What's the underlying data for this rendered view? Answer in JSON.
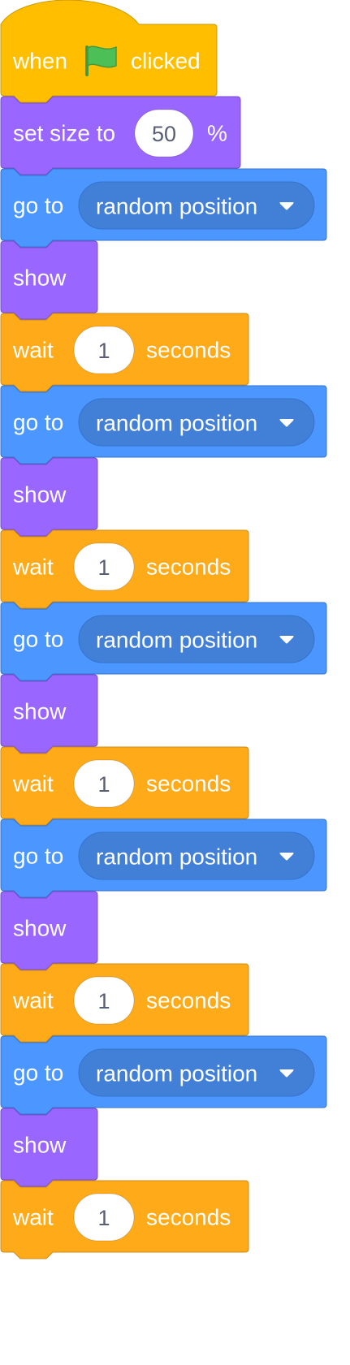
{
  "script": {
    "hat": {
      "when_label": "when",
      "flag_icon": "green-flag-icon",
      "clicked_label": "clicked"
    },
    "set_size": {
      "label": "set size to",
      "value": "50",
      "unit_label": "%"
    },
    "blocks": [
      {
        "type": "goto",
        "label": "go to",
        "menu_value": "random position"
      },
      {
        "type": "show",
        "label": "show"
      },
      {
        "type": "wait",
        "label": "wait",
        "value": "1",
        "unit_label": "seconds"
      },
      {
        "type": "goto",
        "label": "go to",
        "menu_value": "random position"
      },
      {
        "type": "show",
        "label": "show"
      },
      {
        "type": "wait",
        "label": "wait",
        "value": "1",
        "unit_label": "seconds"
      },
      {
        "type": "goto",
        "label": "go to",
        "menu_value": "random position"
      },
      {
        "type": "show",
        "label": "show"
      },
      {
        "type": "wait",
        "label": "wait",
        "value": "1",
        "unit_label": "seconds"
      },
      {
        "type": "goto",
        "label": "go to",
        "menu_value": "random position"
      },
      {
        "type": "show",
        "label": "show"
      },
      {
        "type": "wait",
        "label": "wait",
        "value": "1",
        "unit_label": "seconds"
      },
      {
        "type": "goto",
        "label": "go to",
        "menu_value": "random position"
      },
      {
        "type": "show",
        "label": "show"
      },
      {
        "type": "wait",
        "label": "wait",
        "value": "1",
        "unit_label": "seconds"
      }
    ]
  },
  "colors": {
    "events": "#FFBF00",
    "events_border": "#CC9900",
    "looks": "#9966FF",
    "looks_border": "#774DCB",
    "motion": "#4C97FF",
    "motion_border": "#3373CC",
    "motion_menu": "#4280D7",
    "control": "#FFAB19",
    "control_border": "#CF8B17",
    "input_fill": "#FFFFFF",
    "input_text": "#575E75",
    "flag_green": "#4CBF56",
    "flag_border": "#45993D"
  }
}
